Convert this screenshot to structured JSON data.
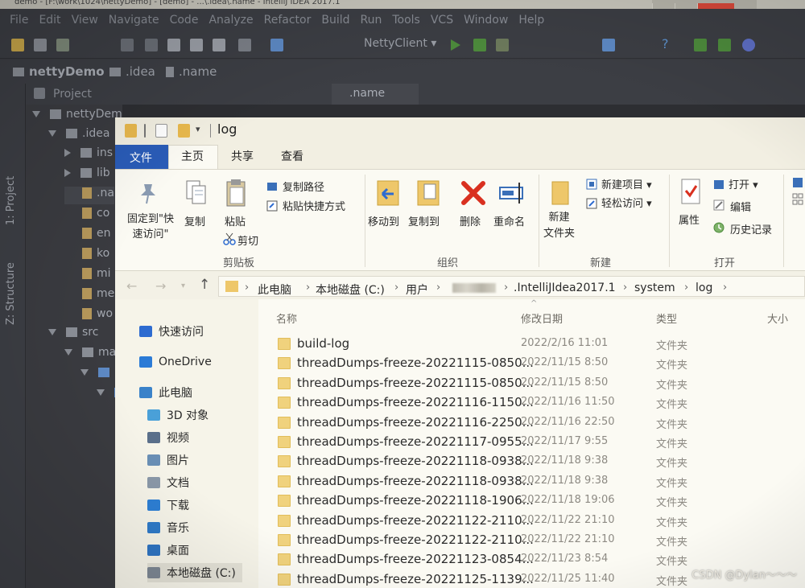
{
  "ide": {
    "title": "demo - [F:\\work\\1024\\nettyDemo] - [demo] - ...\\.idea\\.name - IntelliJ IDEA 2017.1",
    "menu": [
      "File",
      "Edit",
      "View",
      "Navigate",
      "Code",
      "Analyze",
      "Refactor",
      "Build",
      "Run",
      "Tools",
      "VCS",
      "Window",
      "Help"
    ],
    "run_config": "NettyClient ▾",
    "breadcrumbs": [
      "nettyDemo",
      ".idea",
      ".name"
    ],
    "project_label": "Project",
    "editor_tab": ".name",
    "side_tabs": [
      "1: Project",
      "Z: Structure"
    ],
    "tree": [
      {
        "label": "nettyDemo [demo]",
        "arrow": "down",
        "icon": "folder"
      },
      {
        "label": ".idea",
        "arrow": "down",
        "icon": "folder"
      },
      {
        "label": "ins",
        "arrow": "right",
        "icon": "folder"
      },
      {
        "label": "lib",
        "arrow": "right",
        "icon": "folder"
      },
      {
        "label": ".na",
        "arrow": "",
        "icon": "file"
      },
      {
        "label": "co",
        "arrow": "",
        "icon": "file"
      },
      {
        "label": "en",
        "arrow": "",
        "icon": "file"
      },
      {
        "label": "ko",
        "arrow": "",
        "icon": "file"
      },
      {
        "label": "mi",
        "arrow": "",
        "icon": "file"
      },
      {
        "label": "me",
        "arrow": "",
        "icon": "file"
      },
      {
        "label": "wo",
        "arrow": "",
        "icon": "file"
      },
      {
        "label": "src",
        "arrow": "down",
        "icon": "folder"
      },
      {
        "label": "ma",
        "arrow": "down",
        "icon": "folder"
      },
      {
        "label": "",
        "arrow": "down",
        "icon": "folder-blue"
      },
      {
        "label": "",
        "arrow": "down",
        "icon": "folder-blue"
      }
    ]
  },
  "explorer": {
    "title": "log",
    "tabs": {
      "file": "文件",
      "home": "主页",
      "share": "共享",
      "view": "查看"
    },
    "ribbon": {
      "pin": "固定到\"快速访问\"",
      "copy": "复制",
      "paste": "粘贴",
      "copy_path": "复制路径",
      "paste_shortcut": "粘贴快捷方式",
      "cut": "剪切",
      "move_to": "移动到",
      "copy_to": "复制到",
      "delete": "删除",
      "rename": "重命名",
      "new_folder": "新建\n文件夹",
      "new_item": "新建项目 ▾",
      "easy_access": "轻松访问 ▾",
      "properties": "属性",
      "open": "打开 ▾",
      "edit": "编辑",
      "history": "历史记录",
      "groups": {
        "clipboard": "剪贴板",
        "organize": "组织",
        "new": "新建",
        "open": "打开"
      }
    },
    "address": [
      "此电脑",
      "本地磁盘 (C:)",
      "用户",
      "",
      ".IntelliJIdea2017.1",
      "system",
      "log"
    ],
    "nav_pane": [
      {
        "label": "快速访问",
        "icon": "star-icon",
        "color": "#2d6bd0"
      },
      {
        "label": "OneDrive",
        "icon": "cloud-icon",
        "color": "#2b7bd6"
      },
      {
        "label": "此电脑",
        "icon": "computer-icon",
        "color": "#3a82c9"
      },
      {
        "label": "3D 对象",
        "icon": "cube-icon",
        "color": "#4aa0d8"
      },
      {
        "label": "视频",
        "icon": "video-icon",
        "color": "#5a6f8a"
      },
      {
        "label": "图片",
        "icon": "picture-icon",
        "color": "#6a8fb5"
      },
      {
        "label": "文档",
        "icon": "document-icon",
        "color": "#8a98a8"
      },
      {
        "label": "下载",
        "icon": "download-icon",
        "color": "#2d7fd4"
      },
      {
        "label": "音乐",
        "icon": "music-icon",
        "color": "#2f7ac8"
      },
      {
        "label": "桌面",
        "icon": "desktop-icon",
        "color": "#2f74c2"
      },
      {
        "label": "本地磁盘 (C:)",
        "icon": "drive-icon",
        "color": "#7d8793"
      }
    ],
    "columns": {
      "name": "名称",
      "date": "修改日期",
      "type": "类型",
      "size": "大小"
    },
    "files": [
      {
        "name": "build-log",
        "date": "2022/2/16 11:01",
        "type": "文件夹"
      },
      {
        "name": "threadDumps-freeze-20221115-0850...",
        "date": "2022/11/15 8:50",
        "type": "文件夹"
      },
      {
        "name": "threadDumps-freeze-20221115-0850...",
        "date": "2022/11/15 8:50",
        "type": "文件夹"
      },
      {
        "name": "threadDumps-freeze-20221116-1150...",
        "date": "2022/11/16 11:50",
        "type": "文件夹"
      },
      {
        "name": "threadDumps-freeze-20221116-2250...",
        "date": "2022/11/16 22:50",
        "type": "文件夹"
      },
      {
        "name": "threadDumps-freeze-20221117-0955...",
        "date": "2022/11/17 9:55",
        "type": "文件夹"
      },
      {
        "name": "threadDumps-freeze-20221118-0938...",
        "date": "2022/11/18 9:38",
        "type": "文件夹"
      },
      {
        "name": "threadDumps-freeze-20221118-0938...",
        "date": "2022/11/18 9:38",
        "type": "文件夹"
      },
      {
        "name": "threadDumps-freeze-20221118-1906...",
        "date": "2022/11/18 19:06",
        "type": "文件夹"
      },
      {
        "name": "threadDumps-freeze-20221122-2110...",
        "date": "2022/11/22 21:10",
        "type": "文件夹"
      },
      {
        "name": "threadDumps-freeze-20221122-2110...",
        "date": "2022/11/22 21:10",
        "type": "文件夹"
      },
      {
        "name": "threadDumps-freeze-20221123-0854...",
        "date": "2022/11/23 8:54",
        "type": "文件夹"
      },
      {
        "name": "threadDumps-freeze-20221125-1139...",
        "date": "2022/11/25 11:40",
        "type": "文件夹"
      }
    ]
  },
  "watermark": "CSDN @Dylan～～～"
}
